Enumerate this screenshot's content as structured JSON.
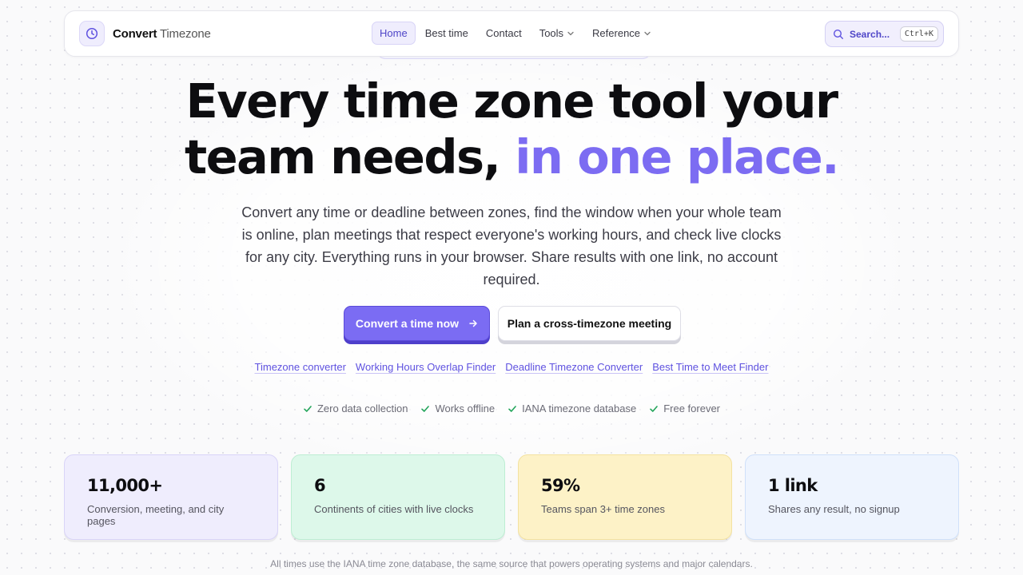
{
  "brand": {
    "name_bold": "Convert",
    "name_light": "Timezone"
  },
  "nav": {
    "links": [
      {
        "label": "Home",
        "active": true
      },
      {
        "label": "Best time",
        "active": false
      },
      {
        "label": "Contact",
        "active": false
      },
      {
        "label": "Tools",
        "active": false,
        "dropdown": true
      },
      {
        "label": "Reference",
        "active": false,
        "dropdown": true
      }
    ]
  },
  "search": {
    "label": "Search...",
    "shortcut": "Ctrl+K"
  },
  "hero": {
    "title_line1": "Every time zone tool your",
    "title_line2_plain": "team needs, ",
    "title_line2_accent": "in one place.",
    "description": "Convert any time or deadline between zones, find the window when your whole team is online, plan meetings that respect everyone's working hours, and check live clocks for any city. Everything runs in your browser. Share results with one link, no account required."
  },
  "cta": {
    "primary": "Convert a time now",
    "secondary": "Plan a cross-timezone meeting"
  },
  "quick_links": [
    "Timezone converter",
    "Working Hours Overlap Finder",
    "Deadline Timezone Converter",
    "Best Time to Meet Finder"
  ],
  "features": [
    "Zero data collection",
    "Works offline",
    "IANA timezone database",
    "Free forever"
  ],
  "stats": [
    {
      "value": "11,000+",
      "label": "Conversion, meeting, and city pages",
      "bg": "#efedfd",
      "border": "#d9d4f8"
    },
    {
      "value": "6",
      "label": "Continents of cities with live clocks",
      "bg": "#ddf8ea",
      "border": "#bdeed3"
    },
    {
      "value": "59%",
      "label": "Teams span 3+ time zones",
      "bg": "#fdf2c7",
      "border": "#f3e2a0"
    },
    {
      "value": "1 link",
      "label": "Shares any result, no signup",
      "bg": "#eef4fe",
      "border": "#cfe0fa"
    }
  ],
  "footnote": "All times use the IANA time zone database, the same source that powers operating systems and major calendars.",
  "colors": {
    "accent": "#7c6cf2",
    "check": "#22a55a"
  }
}
